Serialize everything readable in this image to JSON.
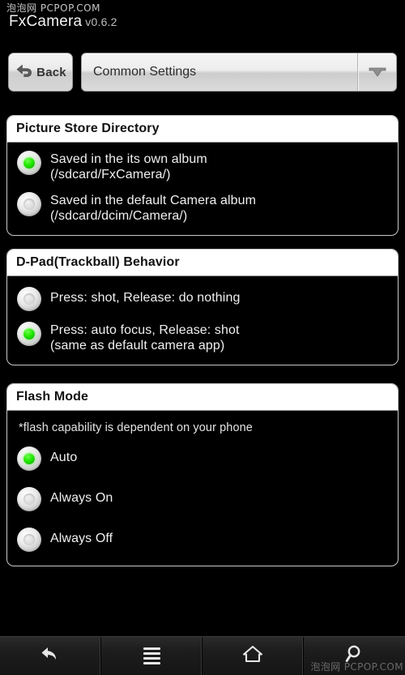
{
  "watermark": {
    "top": "泡泡网 PCPOP.COM",
    "bottom": "泡泡网 PCPOP.COM"
  },
  "app": {
    "name": "FxCamera",
    "version": "v0.6.2"
  },
  "toolbar": {
    "back_label": "Back",
    "back_icon": "back-arrow-icon",
    "spinner_selected": "Common Settings",
    "spinner_arrow_icon": "chevron-down-icon"
  },
  "sections": [
    {
      "title": "Picture Store Directory",
      "note": null,
      "options": [
        {
          "line1": "Saved in the its own album",
          "line2": "(/sdcard/FxCamera/)",
          "checked": true
        },
        {
          "line1": "Saved in the default Camera album",
          "line2": "(/sdcard/dcim/Camera/)",
          "checked": false
        }
      ]
    },
    {
      "title": "D-Pad(Trackball) Behavior",
      "note": null,
      "options": [
        {
          "line1": "Press: shot, Release: do nothing",
          "line2": null,
          "checked": false
        },
        {
          "line1": "Press: auto focus, Release: shot",
          "line2": "(same as default camera app)",
          "checked": true
        }
      ]
    },
    {
      "title": "Flash Mode",
      "note": "*flash capability is dependent on your phone",
      "options": [
        {
          "line1": "Auto",
          "line2": null,
          "checked": true
        },
        {
          "line1": "Always On",
          "line2": null,
          "checked": false
        },
        {
          "line1": "Always Off",
          "line2": null,
          "checked": false
        }
      ]
    }
  ],
  "navbar": {
    "buttons": [
      {
        "icon": "back-arrow-icon",
        "name": "nav-back"
      },
      {
        "icon": "menu-icon",
        "name": "nav-menu"
      },
      {
        "icon": "home-icon",
        "name": "nav-home"
      },
      {
        "icon": "search-icon",
        "name": "nav-search"
      }
    ]
  },
  "colors": {
    "accent_green": "#22e800",
    "background": "#000000",
    "panel_header_bg": "#ffffff",
    "panel_border": "#c9c9c9"
  }
}
